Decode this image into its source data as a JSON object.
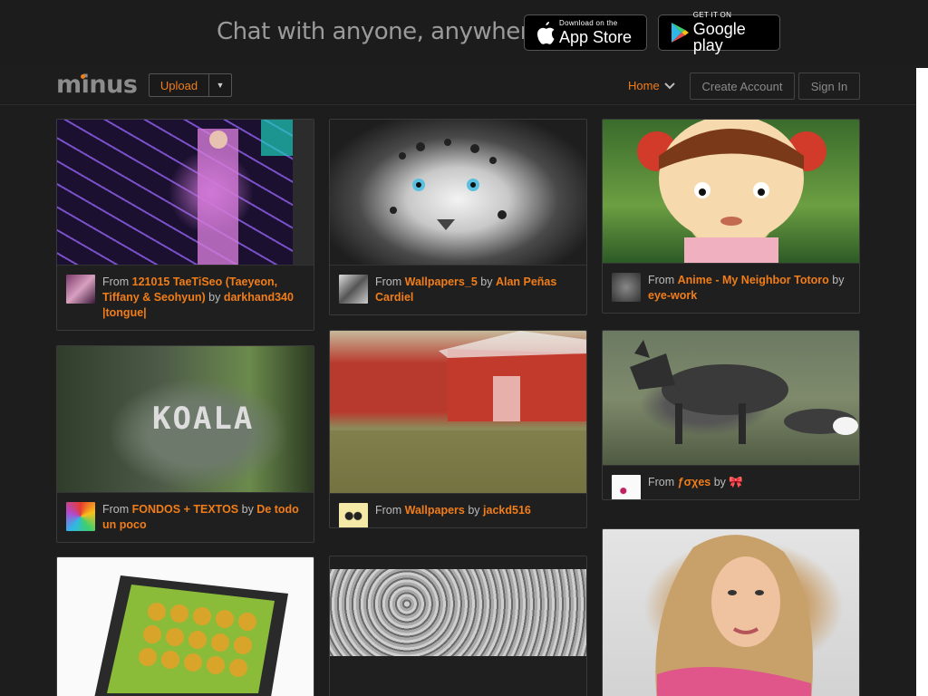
{
  "banner": {
    "tagline": "Chat with anyone, anywhere.",
    "appstore_small": "Download on the",
    "appstore_big": "App Store",
    "googleplay_small": "GET IT ON",
    "googleplay_big": "Google play"
  },
  "nav": {
    "logo": "minus",
    "upload": "Upload",
    "home": "Home",
    "create_account": "Create Account",
    "sign_in": "Sign In"
  },
  "cards": [
    {
      "from": "From ",
      "gallery": "121015 TaeTiSeo (Taeyeon, Tiffany & Seohyun)",
      "by": " by ",
      "user": "darkhand340 |tongue|"
    },
    {
      "from": "From ",
      "gallery": "Wallpapers_5",
      "by": " by ",
      "user": "Alan Peñas Cardiel"
    },
    {
      "from": "From ",
      "gallery": "Anime - My Neighbor Totoro",
      "by": " by ",
      "user": "eye-work"
    },
    {
      "from": "From ",
      "gallery": "FONDOS + TEXTOS",
      "by": " by ",
      "user": "De todo un poco"
    },
    {
      "from": "From ",
      "gallery": "Wallpapers",
      "by": " by ",
      "user": "jackd516"
    },
    {
      "from": "From ",
      "gallery": "ƒσχes",
      "by": " by ",
      "user": "🎀"
    }
  ],
  "art": {
    "koala_text": "KOALA"
  },
  "colors": {
    "accent": "#f07d1a",
    "background": "#1d1d1d"
  }
}
